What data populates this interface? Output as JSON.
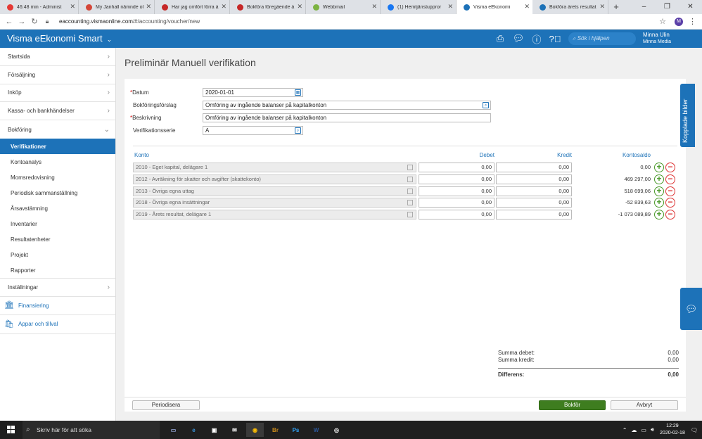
{
  "browser": {
    "tabs": [
      {
        "label": "46:48 min - Administ",
        "icon_color": "#e53935"
      },
      {
        "label": "My Janhall nämnde ol",
        "icon_color": "#d44638"
      },
      {
        "label": "Har jag omfört förra å",
        "icon_color": "#c62828"
      },
      {
        "label": "Bokföra föregående å",
        "icon_color": "#c62828"
      },
      {
        "label": "Webbmail",
        "icon_color": "#7cb342"
      },
      {
        "label": "(1) Hemtjänstuppror",
        "icon_color": "#1877f2"
      },
      {
        "label": "Visma eEkonomi",
        "icon_color": "#1d72b8"
      },
      {
        "label": "Bokföra årets resultat",
        "icon_color": "#1d72b8"
      }
    ],
    "url_host": "eaccounting.vismaonline.com",
    "url_path": "/#/accounting/voucher/new",
    "avatar_letter": "M"
  },
  "app": {
    "brand": "Visma eEkonomi Smart",
    "search_placeholder": "Sök i hjälpen",
    "user_name": "Minna Ulin",
    "company": "Minna Media"
  },
  "sidebar": {
    "top_items": [
      "Startsida",
      "Försäljning",
      "Inköp",
      "Kassa- och bankhändelser"
    ],
    "section": "Bokföring",
    "sub_items": [
      "Verifikationer",
      "Kontoanalys",
      "Momsredovisning",
      "Periodisk sammanställning",
      "Årsavstämning",
      "Inventarier",
      "Resultatenheter",
      "Projekt",
      "Rapporter"
    ],
    "active_sub": "Verifikationer",
    "settings": "Inställningar",
    "financing": "Finansiering",
    "apps": "Appar och tillval"
  },
  "page": {
    "title": "Preliminär Manuell verifikation",
    "fields": {
      "datum_label": "Datum",
      "datum_value": "2020-01-01",
      "forslag_label": "Bokföringsförslag",
      "forslag_value": "Omföring av ingående balanser på kapitalkonton",
      "beskrivning_label": "Beskrivning",
      "beskrivning_value": "Omföring av ingående balanser på kapitalkonton",
      "serie_label": "Verifikationsserie",
      "serie_value": "A"
    },
    "columns": {
      "konto": "Konto",
      "debet": "Debet",
      "kredit": "Kredit",
      "saldo": "Kontosaldo"
    },
    "rows": [
      {
        "account": "2010 - Eget kapital, delägare 1",
        "debet": "0,00",
        "kredit": "0,00",
        "saldo": "0,00"
      },
      {
        "account": "2012 - Avräkning för skatter och avgifter (skattekonto)",
        "debet": "0,00",
        "kredit": "0,00",
        "saldo": "469 297,00"
      },
      {
        "account": "2013 - Övriga egna uttag",
        "debet": "0,00",
        "kredit": "0,00",
        "saldo": "518 699,06"
      },
      {
        "account": "2018 - Övriga egna insättningar",
        "debet": "0,00",
        "kredit": "0,00",
        "saldo": "-52 839,63"
      },
      {
        "account": "2019 - Årets resultat, delägare 1",
        "debet": "0,00",
        "kredit": "0,00",
        "saldo": "-1 073 089,89"
      }
    ],
    "totals": {
      "debet_label": "Summa debet:",
      "debet_value": "0,00",
      "kredit_label": "Summa kredit:",
      "kredit_value": "0,00",
      "diff_label": "Differens:",
      "diff_value": "0,00"
    },
    "buttons": {
      "periodisera": "Periodisera",
      "bokfor": "Bokför",
      "avbryt": "Avbryt"
    },
    "side_tab": "Kopplade bilder"
  },
  "taskbar": {
    "search_placeholder": "Skriv här för att söka",
    "time": "12:29",
    "date": "2020-02-18"
  }
}
